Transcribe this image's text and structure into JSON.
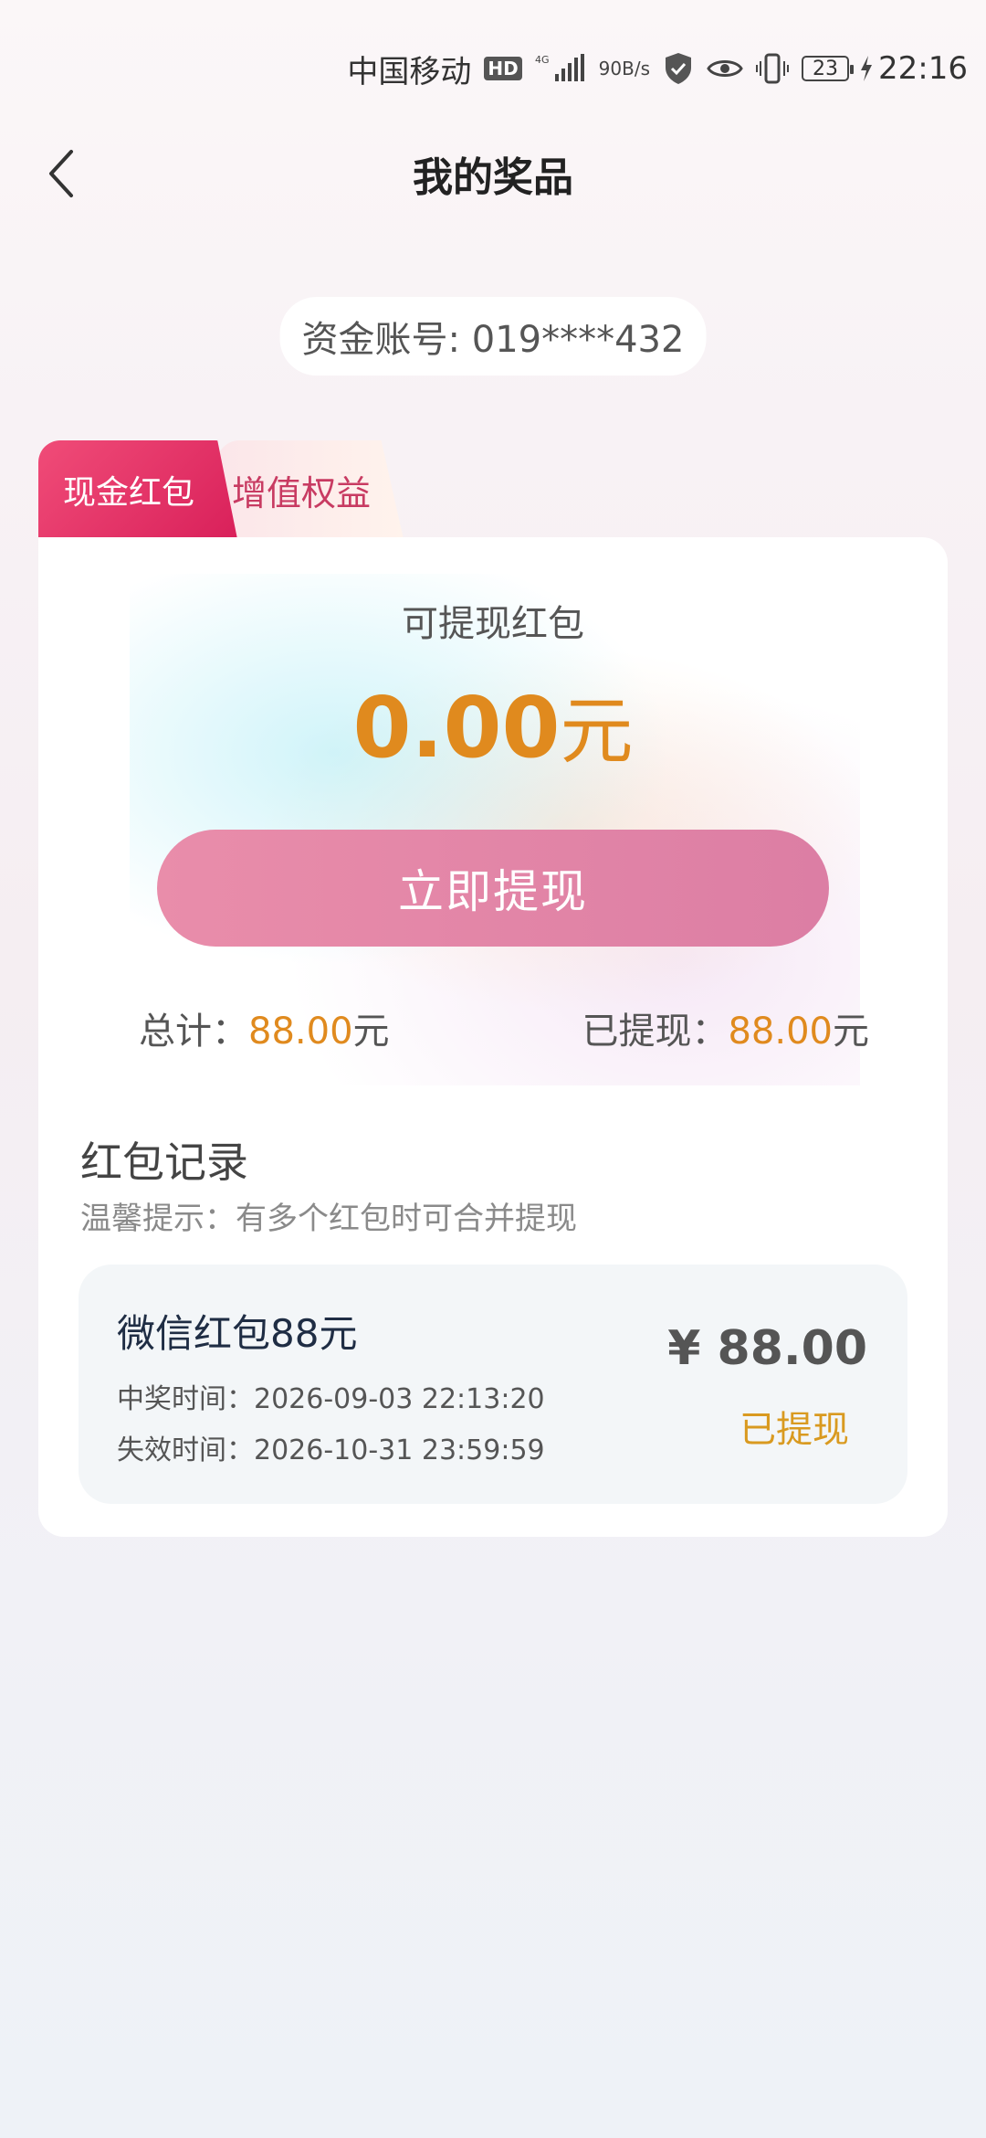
{
  "status_bar": {
    "carrier": "中国移动",
    "hd": "HD",
    "network": "4G",
    "speed_value": "90",
    "speed_unit": "B/s",
    "battery": "23",
    "time": "22:16"
  },
  "header": {
    "title": "我的奖品"
  },
  "account": {
    "text": "资金账号: 019****432"
  },
  "tabs": [
    {
      "label": "现金红包",
      "active": true
    },
    {
      "label": "增值权益",
      "active": false
    }
  ],
  "balance_card": {
    "label": "可提现红包",
    "amount": "0.00",
    "unit": "元",
    "button_label": "立即提现",
    "total_label": "总计：",
    "total_value": "88.00",
    "total_unit": "元",
    "withdrawn_label": "已提现：",
    "withdrawn_value": "88.00",
    "withdrawn_unit": "元"
  },
  "records": {
    "title": "红包记录",
    "tip": "温馨提示：有多个红包时可合并提现",
    "items": [
      {
        "title": "微信红包88元",
        "win_time": "中奖时间：2026-09-03 22:13:20",
        "expire_time": "失效时间：2026-10-31 23:59:59",
        "amount": "¥ 88.00",
        "status": "已提现"
      }
    ]
  },
  "colors": {
    "accent_orange": "#e08a1e",
    "tab_active": "#e0285e",
    "button_pink": "#e08aa8",
    "status_gold": "#d99a20"
  },
  "icons": [
    "back-arrow-icon",
    "signal-icon",
    "shield-icon",
    "eye-icon",
    "vibrate-icon",
    "battery-icon",
    "charging-icon"
  ]
}
